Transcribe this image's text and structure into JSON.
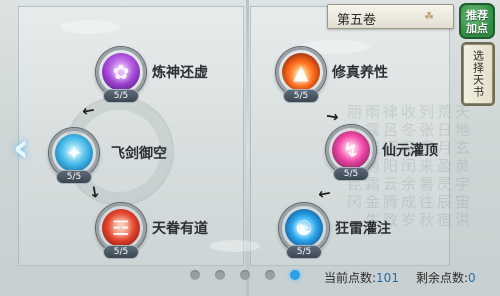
{
  "volume_selector": {
    "label": "第五卷",
    "icon": "lotus-icon"
  },
  "recommend_button": {
    "line1": "推荐",
    "line2": "加点"
  },
  "choose_book_button": {
    "label": "选择天书"
  },
  "nav": {
    "prev_icon": "chevron-left-icon"
  },
  "left_column": [
    {
      "id": "lianshen",
      "label": "炼神还虚",
      "level": "5/5",
      "icon": "purple-spirit-icon"
    },
    {
      "id": "feijian",
      "label": "飞剑御空",
      "level": "5/5",
      "icon": "blue-sword-icon"
    },
    {
      "id": "tianjuan",
      "label": "天眷有道",
      "level": "5/5",
      "icon": "red-blessing-icon"
    }
  ],
  "right_column": [
    {
      "id": "xiuzhen",
      "label": "修真养性",
      "level": "5/5",
      "icon": "fire-meditation-icon"
    },
    {
      "id": "xianyuan",
      "label": "仙元灌顶",
      "level": "5/5",
      "icon": "pink-lightning-icon"
    },
    {
      "id": "kuanglei",
      "label": "狂雷灌注",
      "level": "5/5",
      "icon": "blue-thunder-icon"
    }
  ],
  "pagination": {
    "pages": 5,
    "active_index": 4
  },
  "status": {
    "current_points_label": "当前点数:",
    "current_points_value": "101",
    "remaining_points_label": "剩余点数:",
    "remaining_points_value": "0"
  },
  "background_calligraphy": "天地玄黄宇宙洪荒日月盈昃辰宿列张寒来暑往秋收冬藏闰余成岁律吕调阳云腾致雨露结为霜金生丽水玉出昆冈"
}
